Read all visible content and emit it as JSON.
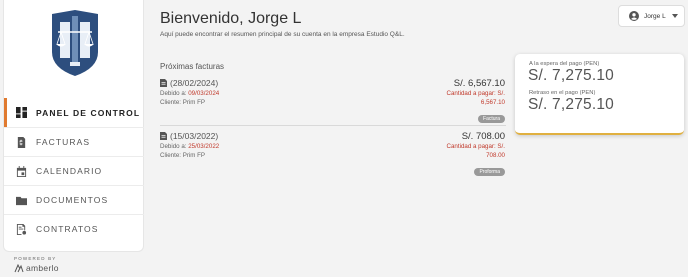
{
  "sidebar": {
    "items": [
      {
        "label": "PANEL DE CONTROL",
        "icon": "dashboard-icon",
        "active": true
      },
      {
        "label": "FACTURAS",
        "icon": "invoice-icon",
        "active": false
      },
      {
        "label": "CALENDARIO",
        "icon": "calendar-icon",
        "active": false
      },
      {
        "label": "DOCUMENTOS",
        "icon": "folder-icon",
        "active": false
      },
      {
        "label": "CONTRATOS",
        "icon": "contract-icon",
        "active": false
      }
    ],
    "powered_label": "POWERED BY",
    "powered_brand": "amberlo"
  },
  "header": {
    "title": "Bienvenido, Jorge L",
    "subtitle": "Aquí puede encontrar el resumen principal de su cuenta en la empresa Estudio Q&L.",
    "user_name": "Jorge L"
  },
  "invoices": {
    "section_title": "Próximas facturas",
    "items": [
      {
        "date": "(28/02/2024)",
        "due_label": "Debido a:",
        "due_date": "09/03/2024",
        "client_label": "Cliente:",
        "client": "Prim FP",
        "amount": "S/. 6,567.10",
        "pending_line1": "Cantidad a pagar: S/.",
        "pending_line2": "6,567.10",
        "badge": "Factura"
      },
      {
        "date": "(15/03/2022)",
        "due_label": "Debido a:",
        "due_date": "25/03/2022",
        "client_label": "Cliente:",
        "client": "Prim FP",
        "amount": "S/. 708.00",
        "pending_line1": "Cantidad a pagar: S/.",
        "pending_line2": "708.00",
        "badge": "Proforma"
      }
    ]
  },
  "summary": {
    "pending_label": "A la espera del pago (PEN)",
    "pending_value": "S/. 7,275.10",
    "overdue_label": "Retraso en el pago (PEN)",
    "overdue_value": "S/. 7,275.10"
  },
  "colors": {
    "accent": "#e07a2f",
    "danger": "#c0392b",
    "logo_blue": "#2d4e7e",
    "card_border": "#e0b040"
  }
}
